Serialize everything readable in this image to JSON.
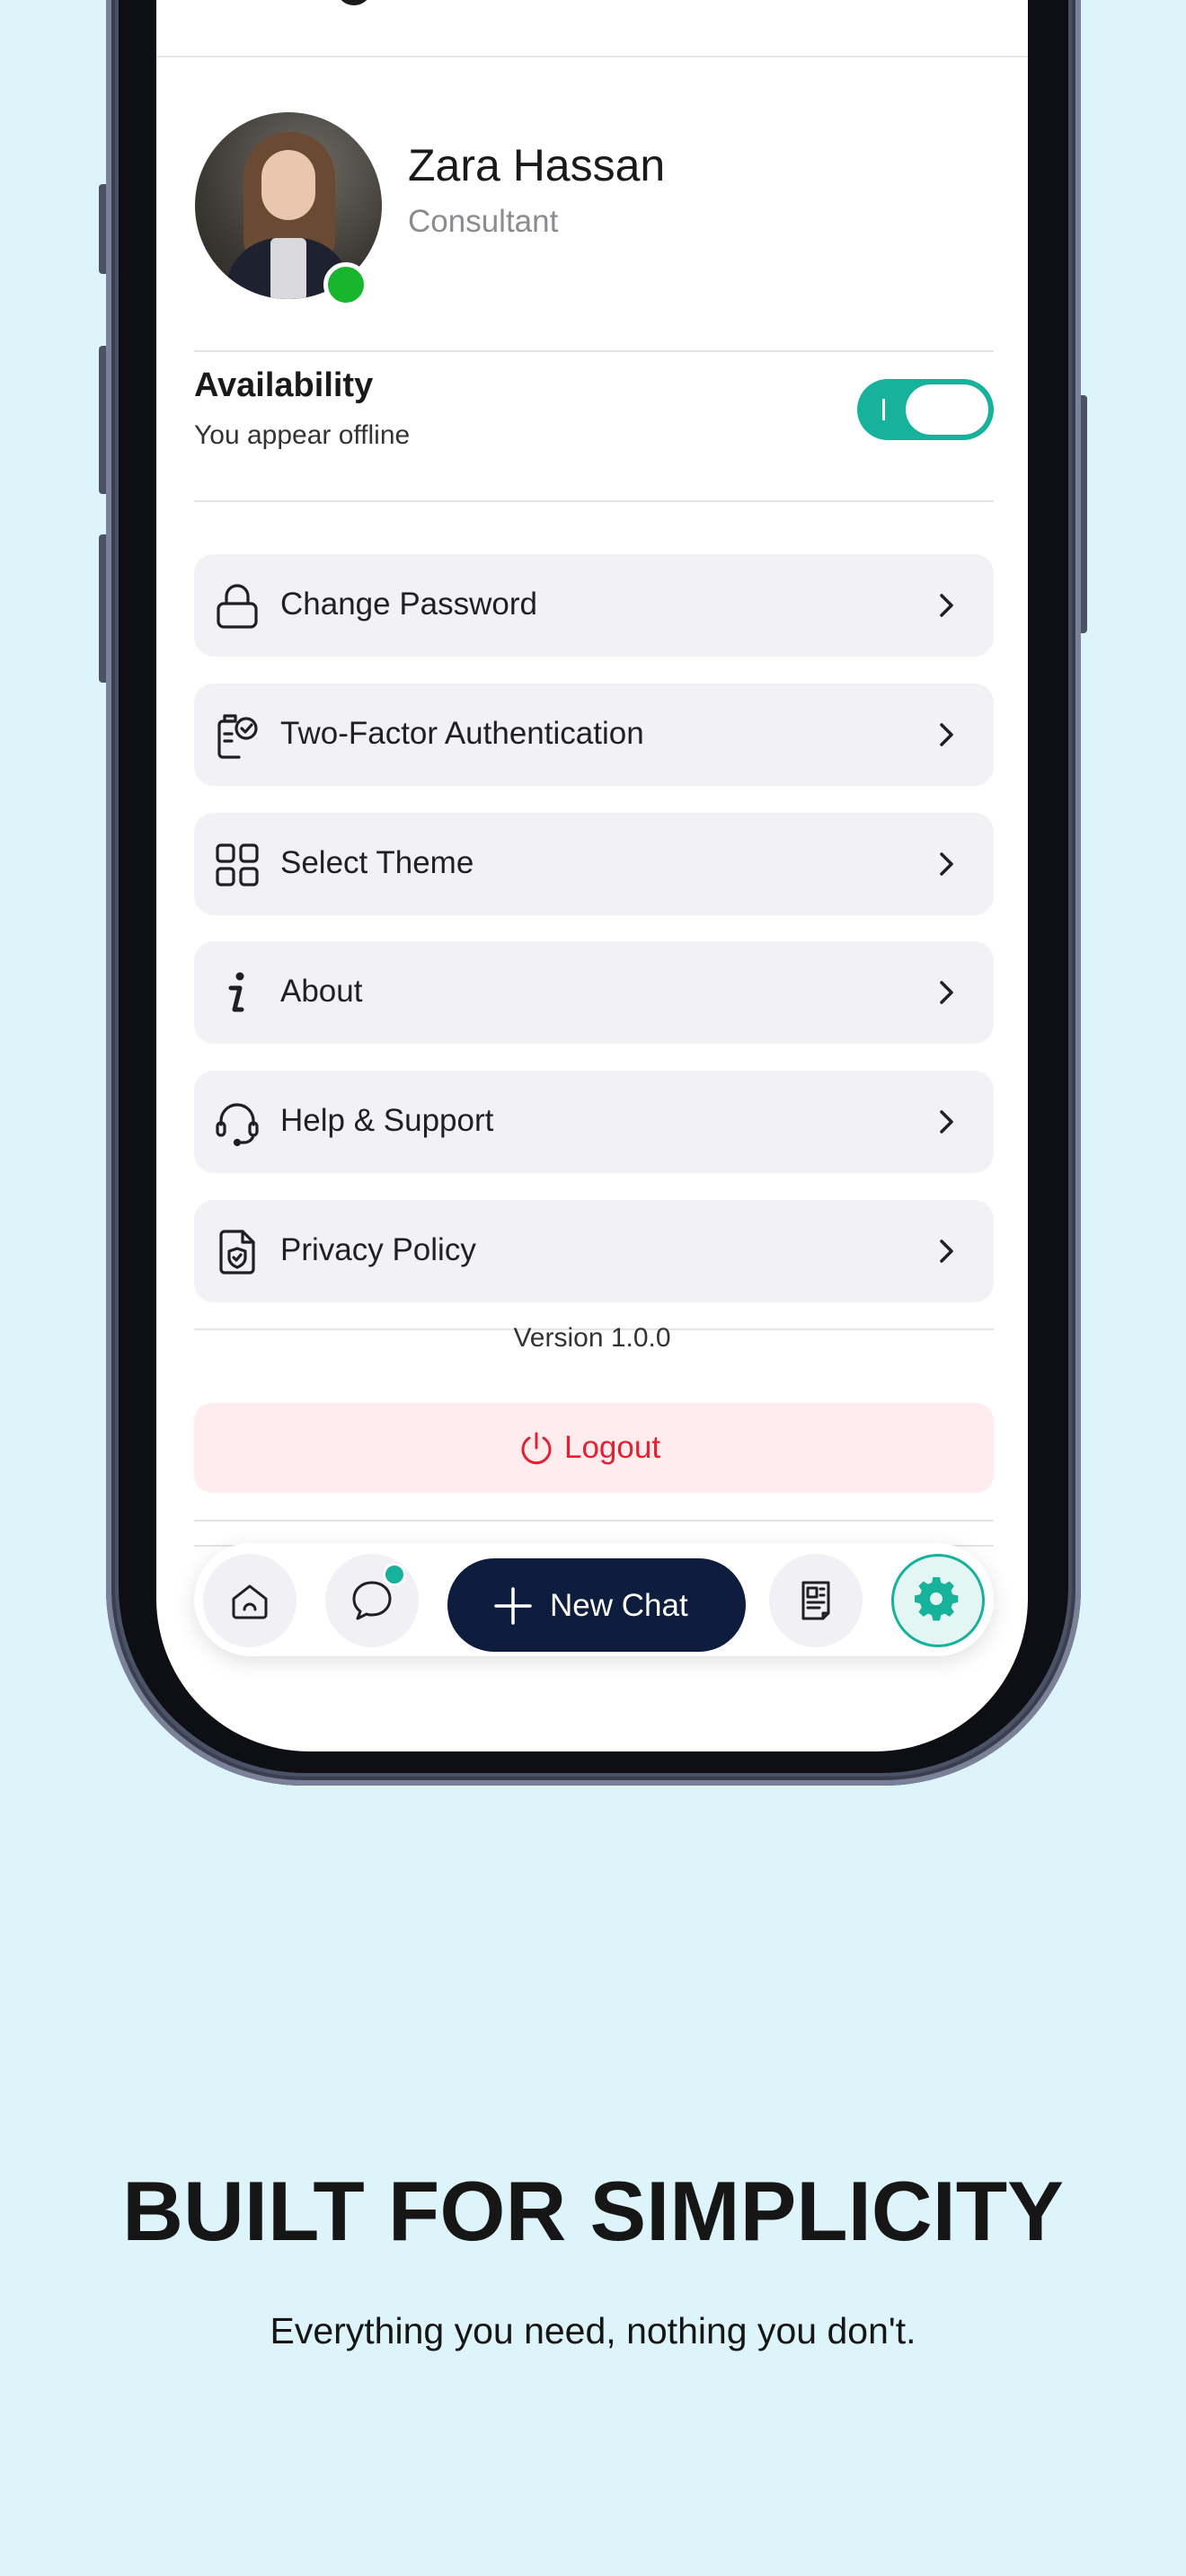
{
  "profile": {
    "name": "Zara Hassan",
    "role": "Consultant",
    "status": "online"
  },
  "availability": {
    "title": "Availability",
    "subtitle": "You appear offline",
    "toggle_on": true
  },
  "menu": [
    {
      "label": "Change Password",
      "icon": "lock-icon"
    },
    {
      "label": "Two-Factor Authentication",
      "icon": "shield-check-icon"
    },
    {
      "label": "Select Theme",
      "icon": "grid-icon"
    },
    {
      "label": "About",
      "icon": "info-icon"
    },
    {
      "label": "Help & Support",
      "icon": "headset-icon"
    },
    {
      "label": "Privacy Policy",
      "icon": "document-shield-icon"
    }
  ],
  "version": "Version 1.0.0",
  "logout": {
    "label": "Logout",
    "color": "#E32131"
  },
  "bottom_nav": {
    "new_chat_label": "New Chat",
    "items": [
      "home-icon",
      "chat-icon",
      "document-icon",
      "settings-icon"
    ],
    "active": "settings-icon"
  },
  "marketing": {
    "headline": "BUILT FOR SIMPLICITY",
    "subline": "Everything you need, nothing you don't."
  },
  "colors": {
    "background": "#DDF4FA",
    "accent": "#16B29C",
    "primary_dark": "#0E1D3D",
    "online": "#18B62D"
  }
}
